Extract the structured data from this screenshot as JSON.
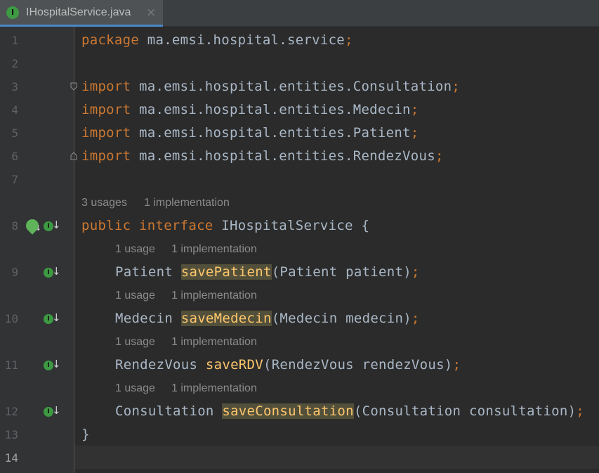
{
  "tab": {
    "filename": "IHospitalService.java",
    "icon": "interface-icon",
    "icon_letter": "I",
    "close": "×"
  },
  "lines": {
    "l1": {
      "num": "1",
      "package_kw": "package",
      "package_name": " ma.emsi.hospital.service",
      "semi": ";"
    },
    "l2": {
      "num": "2"
    },
    "l3": {
      "num": "3",
      "import_kw": "import",
      "path": " ma.emsi.hospital.entities.Consultation",
      "semi": ";"
    },
    "l4": {
      "num": "4",
      "import_kw": "import",
      "path": " ma.emsi.hospital.entities.Medecin",
      "semi": ";"
    },
    "l5": {
      "num": "5",
      "import_kw": "import",
      "path": " ma.emsi.hospital.entities.Patient",
      "semi": ";"
    },
    "l6": {
      "num": "6",
      "import_kw": "import",
      "path": " ma.emsi.hospital.entities.RendezVous",
      "semi": ";"
    },
    "l7": {
      "num": "7"
    },
    "l8": {
      "num": "8",
      "public_kw": "public",
      "interface_kw": " interface",
      "name": " IHospitalService {"
    },
    "l9": {
      "num": "9",
      "ret": "Patient ",
      "method": "savePatient",
      "params": "(Patient patient)",
      "semi": ";"
    },
    "l10": {
      "num": "10",
      "ret": "Medecin ",
      "method": "saveMedecin",
      "params": "(Medecin medecin)",
      "semi": ";"
    },
    "l11": {
      "num": "11",
      "ret": "RendezVous ",
      "method": "saveRDV",
      "params": "(RendezVous rendezVous)",
      "semi": ";"
    },
    "l12": {
      "num": "12",
      "ret": "Consultation ",
      "method": "saveConsultation",
      "params": "(Consultation consultation)",
      "semi": ";"
    },
    "l13": {
      "num": "13",
      "brace": "}"
    },
    "l14": {
      "num": "14"
    }
  },
  "hints": {
    "interface": {
      "usages": "3 usages",
      "impl": "1 implementation"
    },
    "savePatient": {
      "usages": "1 usage",
      "impl": "1 implementation"
    },
    "saveMedecin": {
      "usages": "1 usage",
      "impl": "1 implementation"
    },
    "saveRDV": {
      "usages": "1 usage",
      "impl": "1 implementation"
    },
    "saveConsultation": {
      "usages": "1 usage",
      "impl": "1 implementation"
    }
  },
  "gutter_icon_letter": "I",
  "gutter_arrow": "↓",
  "colors": {
    "keyword": "#cc7832",
    "method": "#ffc66d",
    "text": "#a9b7c6",
    "background": "#2b2b2b",
    "interface_icon": "#3d9a42"
  }
}
